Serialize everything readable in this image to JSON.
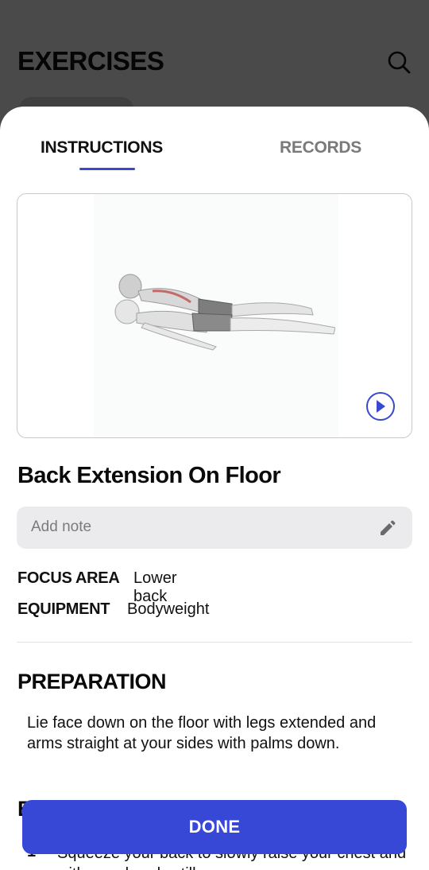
{
  "background": {
    "title": "EXERCISES"
  },
  "tabs": [
    {
      "label": "INSTRUCTIONS",
      "active": true
    },
    {
      "label": "RECORDS",
      "active": false
    }
  ],
  "exercise": {
    "name": "Back Extension On Floor",
    "note_placeholder": "Add note",
    "focus_area_label": "FOCUS AREA",
    "focus_area_value": "Lower back",
    "equipment_label": "EQUIPMENT",
    "equipment_value": "Bodyweight"
  },
  "preparation": {
    "title": "PREPARATION",
    "text": "Lie face down on the floor with legs extended and arms straight at your sides with palms down."
  },
  "execution": {
    "title_initial": "E",
    "steps": [
      {
        "number": "1",
        "text": "Squeeze your back to slowly raise your chest and with your hands still"
      }
    ]
  },
  "done_button": "DONE",
  "colors": {
    "accent": "#3848d6",
    "overlay": "#4a4a4a",
    "note_bg": "#ebebed"
  }
}
